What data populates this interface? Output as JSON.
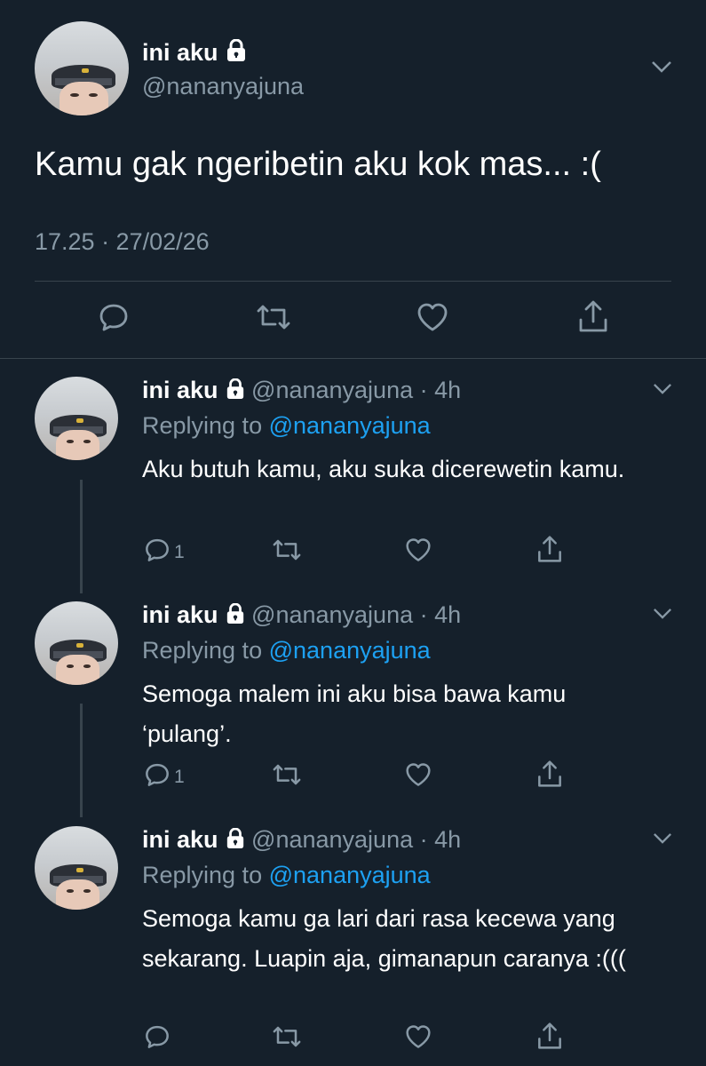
{
  "main_tweet": {
    "display_name": "ini aku",
    "handle": "@nananyajuna",
    "text": "Kamu gak ngeribetin aku kok mas... :(",
    "timestamp": "17.25 · 27/02/26"
  },
  "replies": [
    {
      "display_name": "ini aku",
      "handle": "@nananyajuna",
      "time": "· 4h",
      "replying_prefix": "Replying to",
      "replying_to": "@nananyajuna",
      "text": "Aku butuh kamu, aku suka dicerewetin kamu.",
      "reply_count": "1"
    },
    {
      "display_name": "ini aku",
      "handle": "@nananyajuna",
      "time": "· 4h",
      "replying_prefix": "Replying to",
      "replying_to": "@nananyajuna",
      "text": "Semoga malem ini aku bisa bawa kamu ‘pulang’.",
      "reply_count": "1"
    },
    {
      "display_name": "ini aku",
      "handle": "@nananyajuna",
      "time": "· 4h",
      "replying_prefix": "Replying to",
      "replying_to": "@nananyajuna",
      "text": "Semoga kamu ga lari dari rasa kecewa yang sekarang. Luapin aja, gimanapun caranya :(((",
      "reply_count": ""
    }
  ],
  "icons": {
    "reply": "reply-icon",
    "retweet": "retweet-icon",
    "like": "heart-icon",
    "share": "share-icon",
    "lock": "lock-icon",
    "more": "chevron-down-icon"
  },
  "colors": {
    "background": "#15202b",
    "secondary_text": "#8899a6",
    "link": "#1da1f2",
    "divider": "#38444d"
  }
}
